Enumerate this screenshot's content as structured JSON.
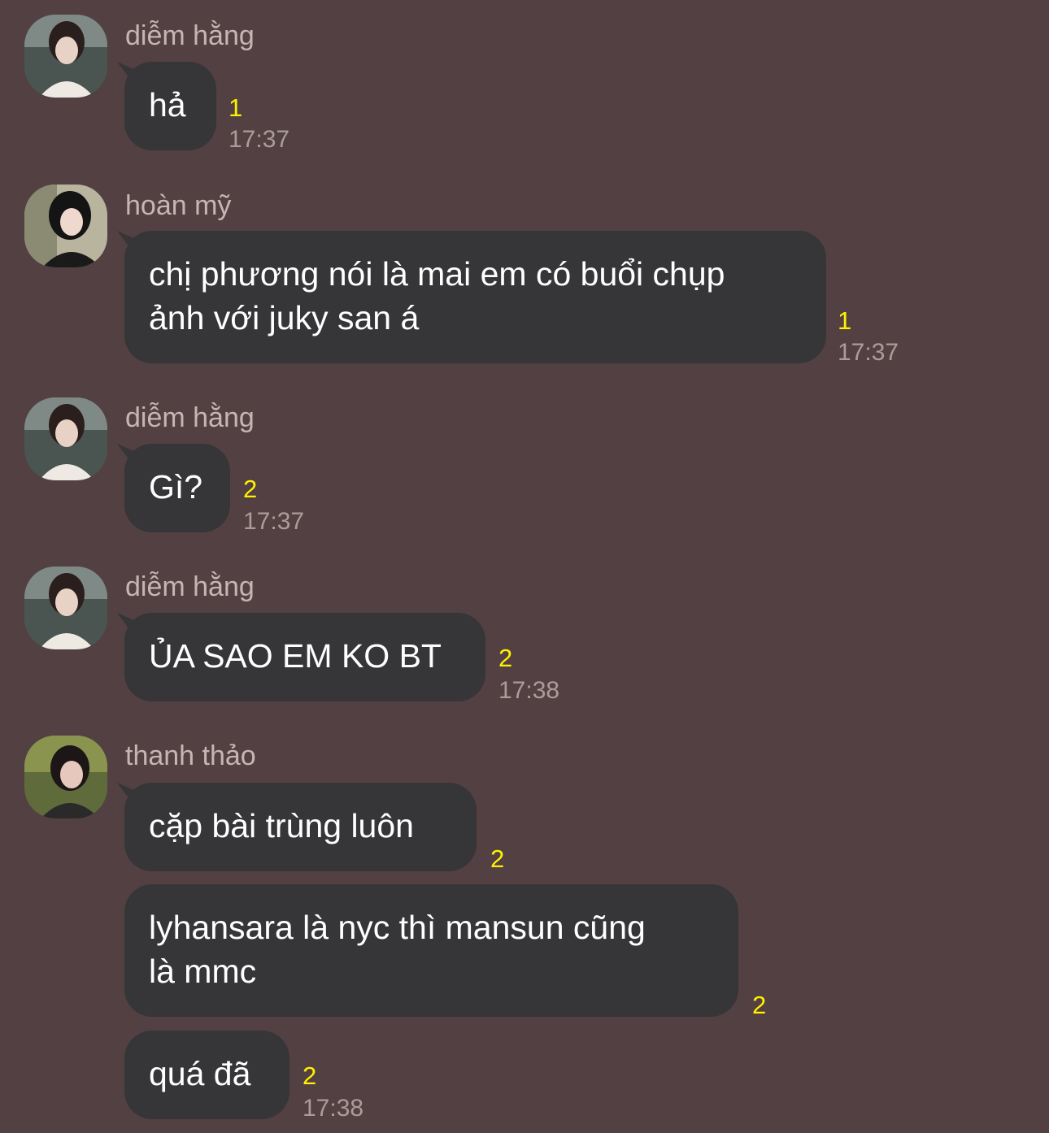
{
  "messages": [
    {
      "sender": "diễm hằng",
      "avatar_icon": "user-avatar-icon",
      "bubbles": [
        {
          "text": "hả",
          "unread": "1",
          "time": "17:37"
        }
      ]
    },
    {
      "sender": "hoàn mỹ",
      "avatar_icon": "user-avatar-icon",
      "bubbles": [
        {
          "text_lines": [
            "chị phương nói là mai em có buổi chụp",
            "ảnh với juky san á"
          ],
          "unread": "1",
          "time": "17:37"
        }
      ]
    },
    {
      "sender": "diễm hằng",
      "avatar_icon": "user-avatar-icon",
      "bubbles": [
        {
          "text": "Gì?",
          "unread": "2",
          "time": "17:37"
        }
      ]
    },
    {
      "sender": "diễm hằng",
      "avatar_icon": "user-avatar-icon",
      "bubbles": [
        {
          "text": "ỦA SAO EM KO BT",
          "unread": "2",
          "time": "17:38"
        }
      ]
    },
    {
      "sender": "thanh thảo",
      "avatar_icon": "user-avatar-icon",
      "bubbles": [
        {
          "text": "cặp bài trùng luôn",
          "unread": "2"
        },
        {
          "text_lines": [
            "lyhansara là nyc thì mansun cũng",
            "là mmc"
          ],
          "unread": "2"
        },
        {
          "text": "quá đã",
          "unread": "2",
          "time": "17:38"
        }
      ]
    }
  ],
  "colors": {
    "background": "#534042",
    "bubble": "#363537",
    "unread": "#fff200",
    "time": "#a99d9b",
    "name": "#c4b6b3"
  }
}
